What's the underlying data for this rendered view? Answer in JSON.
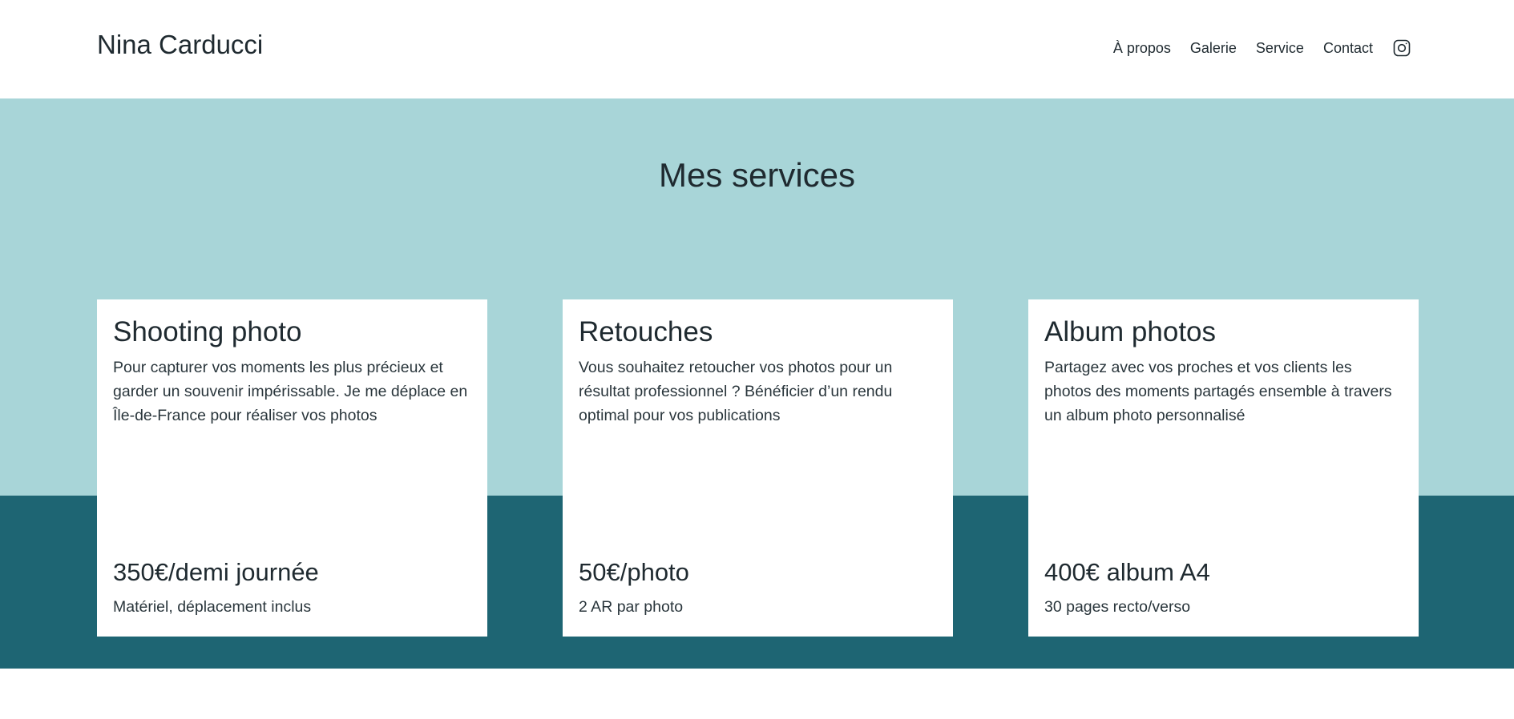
{
  "header": {
    "brand": "Nina Carducci",
    "nav": [
      {
        "label": "À propos"
      },
      {
        "label": "Galerie"
      },
      {
        "label": "Service"
      },
      {
        "label": "Contact"
      }
    ],
    "social_icon": "instagram-icon"
  },
  "services": {
    "title": "Mes services",
    "cards": [
      {
        "title": "Shooting photo",
        "description": "Pour capturer vos moments les plus précieux et garder un souvenir impérissable. Je me déplace en Île-de-France pour réaliser vos photos",
        "price": "350€/demi journée",
        "note": "Matériel, déplacement inclus"
      },
      {
        "title": "Retouches",
        "description": "Vous souhaitez retoucher vos photos pour un résultat professionnel ? Bénéficier d’un rendu optimal pour vos publications",
        "price": "50€/photo",
        "note": "2 AR par photo"
      },
      {
        "title": "Album photos",
        "description": "Partagez avec vos proches et vos clients les photos des moments partagés ensemble à travers un album photo personnalisé",
        "price": "400€ album A4",
        "note": "30 pages recto/verso"
      }
    ]
  },
  "colors": {
    "band_light": "#a8d5d8",
    "band_dark": "#1e6573",
    "text": "#1f2a30",
    "card_bg": "#ffffff"
  }
}
